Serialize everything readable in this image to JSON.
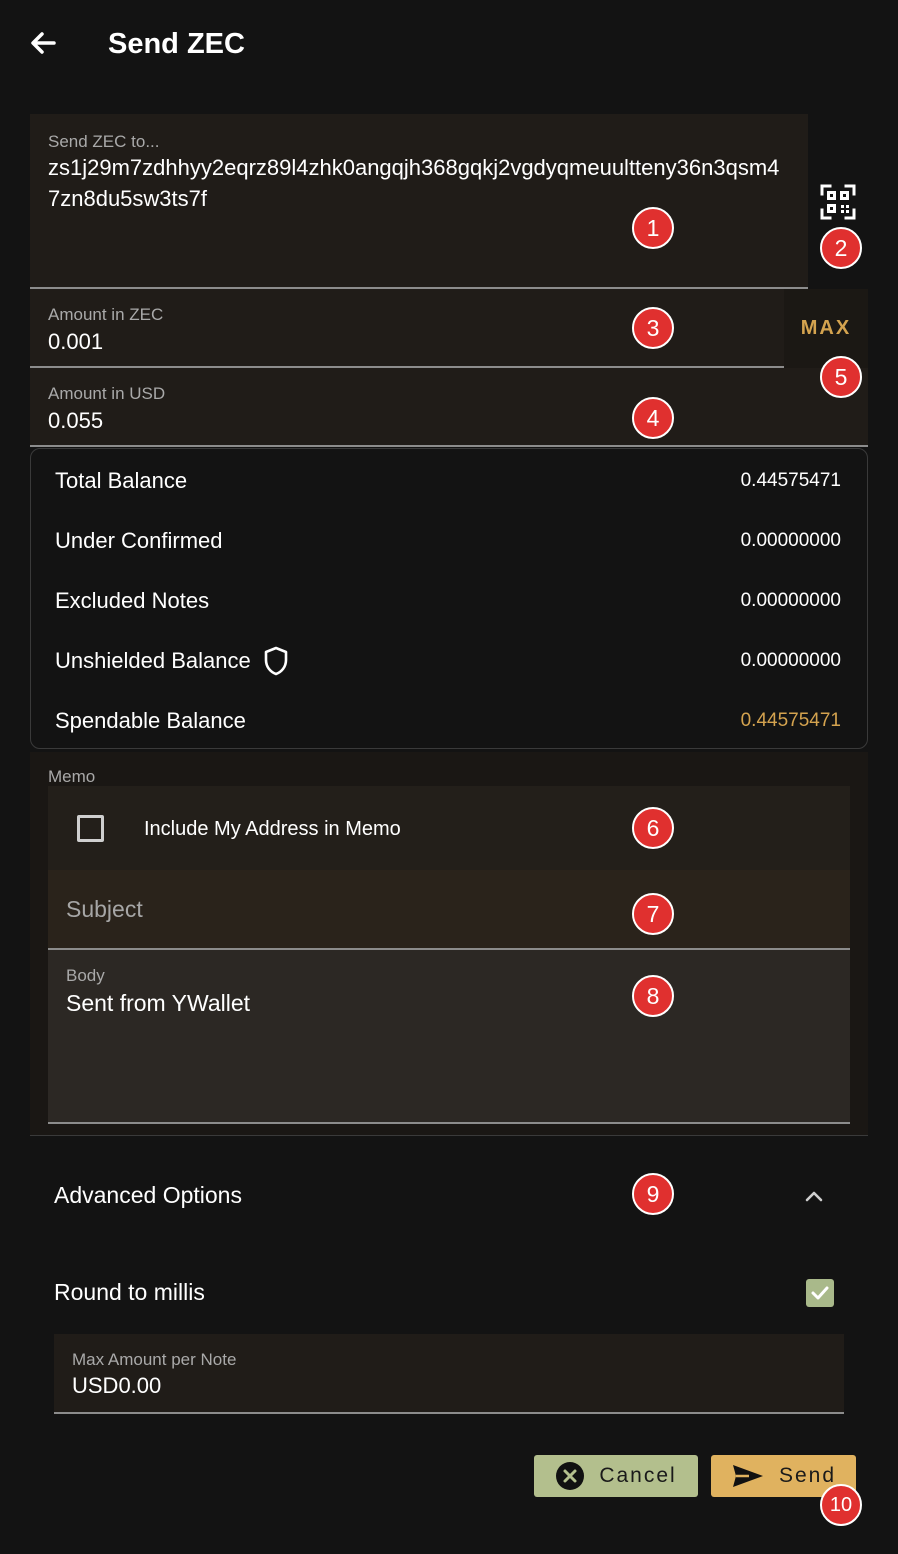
{
  "header": {
    "title": "Send ZEC"
  },
  "send_to": {
    "label": "Send ZEC to...",
    "value": "zs1j29m7zdhhyy2eqrz89l4zhk0angqjh368gqkj2vgdyqmeuultteny36n3qsm47zn8du5sw3ts7f"
  },
  "amount_zec": {
    "label": "Amount in ZEC",
    "value": "0.001"
  },
  "max_button": "MAX",
  "amount_usd": {
    "label": "Amount in USD",
    "value": "0.055"
  },
  "balances": [
    {
      "label": "Total Balance",
      "value": "0.44575471"
    },
    {
      "label": "Under Confirmed",
      "value": "0.00000000"
    },
    {
      "label": "Excluded Notes",
      "value": "0.00000000"
    },
    {
      "label": "Unshielded Balance",
      "value": "0.00000000",
      "icon": "shield-icon"
    },
    {
      "label": "Spendable Balance",
      "value": "0.44575471",
      "color": "#d4a34f"
    }
  ],
  "memo": {
    "label": "Memo",
    "include_address_label": "Include My Address in Memo",
    "include_address_checked": false,
    "subject_placeholder": "Subject",
    "body_label": "Body",
    "body_value": "Sent from YWallet"
  },
  "advanced": {
    "label": "Advanced Options",
    "expanded": true,
    "round_label": "Round to millis",
    "round_checked": true,
    "max_note_label": "Max Amount per Note",
    "max_note_value": "USD0.00"
  },
  "buttons": {
    "cancel": "Cancel",
    "send": "Send"
  },
  "annotations": [
    "1",
    "2",
    "3",
    "4",
    "5",
    "6",
    "7",
    "8",
    "9",
    "10"
  ],
  "colors": {
    "background": "#131313",
    "accent": "#d4a34f",
    "cancel": "#b3bf8d",
    "send": "#e0b25f",
    "badge": "#e0302f"
  }
}
